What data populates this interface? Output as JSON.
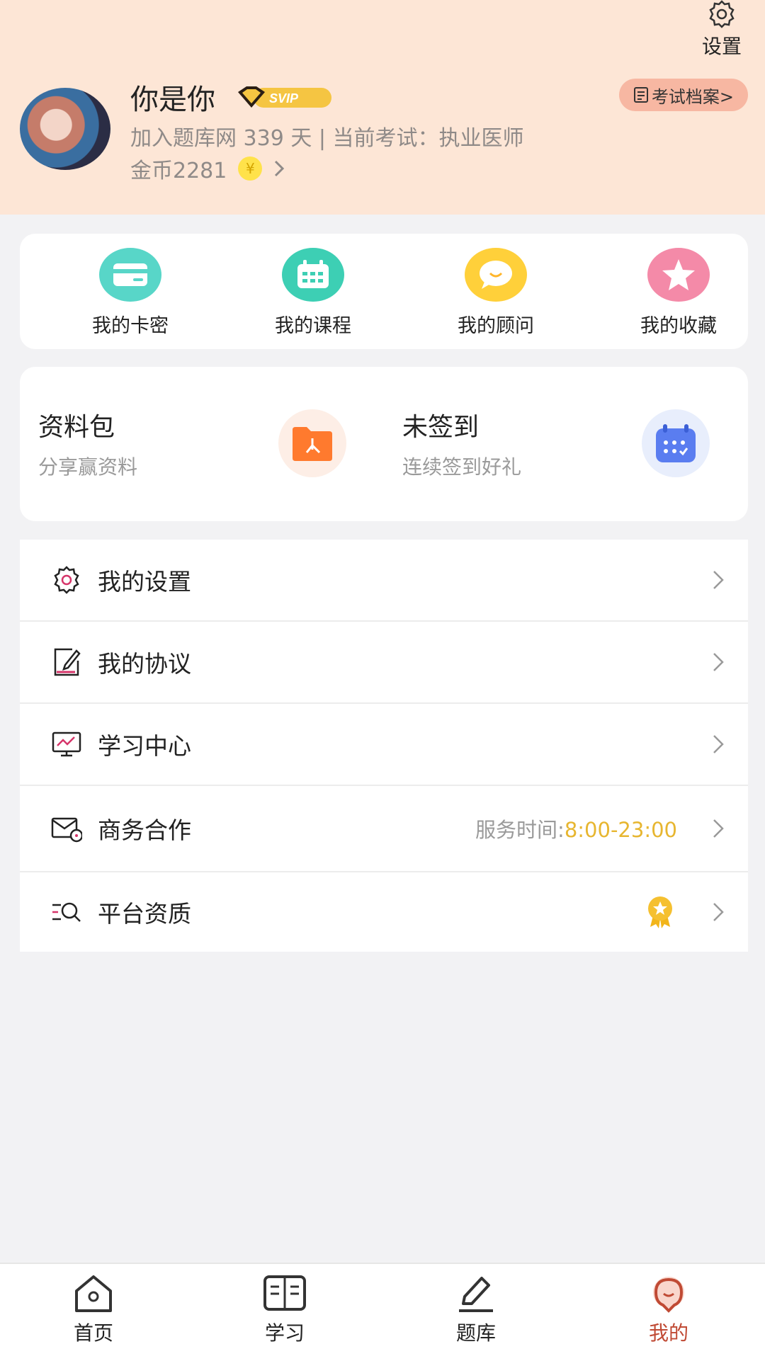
{
  "header": {
    "settings_label": "设置",
    "username": "你是你",
    "badge": "SVIP",
    "info": "加入题库网 339 天 | 当前考试：执业医师",
    "coins": "金币2281",
    "coin_symbol": "¥",
    "exam_archive": "考试档案>"
  },
  "quick_actions": [
    {
      "label": "我的卡密",
      "icon": "card-icon"
    },
    {
      "label": "我的课程",
      "icon": "calendar-icon"
    },
    {
      "label": "我的顾问",
      "icon": "chat-icon"
    },
    {
      "label": "我的收藏",
      "icon": "star-icon"
    }
  ],
  "promo": {
    "left": {
      "title": "资料包",
      "subtitle": "分享赢资料",
      "icon": "pdf-folder-icon"
    },
    "right": {
      "title": "未签到",
      "subtitle": "连续签到好礼",
      "icon": "checkin-calendar-icon"
    }
  },
  "menu": [
    {
      "label": "我的设置",
      "icon": "gear-icon"
    },
    {
      "label": "我的协议",
      "icon": "edit-document-icon"
    },
    {
      "label": "学习中心",
      "icon": "monitor-icon"
    },
    {
      "label": "商务合作",
      "icon": "mail-icon",
      "extra_label": "服务时间:",
      "extra_time": "8:00-23:00"
    },
    {
      "label": "平台资质",
      "icon": "search-list-icon",
      "badge_icon": "award-icon"
    }
  ],
  "tabs": [
    {
      "label": "首页",
      "icon": "home-icon"
    },
    {
      "label": "学习",
      "icon": "book-icon"
    },
    {
      "label": "题库",
      "icon": "pencil-icon"
    },
    {
      "label": "我的",
      "icon": "profile-icon",
      "active": true
    }
  ],
  "colors": {
    "header_bg": "#fde6d6",
    "accent_time": "#e7b630",
    "active_tab": "#c04a34"
  }
}
